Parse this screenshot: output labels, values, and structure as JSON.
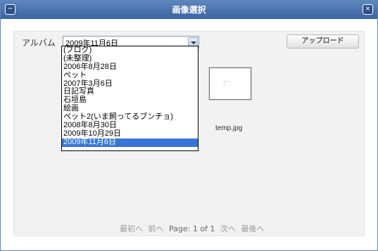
{
  "window": {
    "title": "画像選択",
    "minimize_symbol": "−",
    "close_symbol": "×"
  },
  "toolbar": {
    "album_label": "アルバム",
    "album_selected": "2009年11月6日",
    "upload_label": "アップロード"
  },
  "album_options": [
    "(ブログ)",
    "(未整理)",
    "2006年8月28日",
    "ペット",
    "2007年3月6日",
    "日記写真",
    "石垣島",
    "絵画",
    "ペット2(いま飼ってるブンチョ)",
    "2008年8月30日",
    "2009年10月29日",
    "2009年11月6日"
  ],
  "gallery": {
    "items": [
      {
        "filename": "temp.jpg"
      }
    ]
  },
  "pager": {
    "first": "最初へ",
    "prev": "前へ",
    "page_info": "Page: 1 of 1",
    "next": "次へ",
    "last": "最後へ"
  },
  "icons": {
    "minimize": "minimize-icon",
    "close": "close-icon",
    "dropdown": "chevron-down-icon"
  }
}
